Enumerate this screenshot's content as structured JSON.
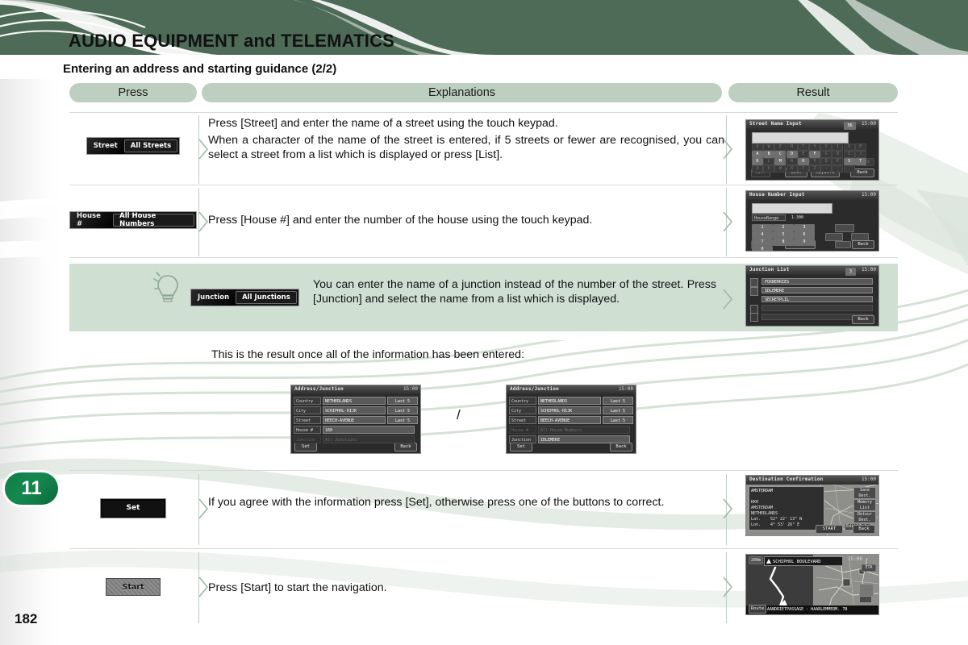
{
  "header": {
    "chapter_title": "AUDIO EQUIPMENT and TELEMATICS",
    "section_title": "Entering an address and starting guidance (2/2)",
    "band_color": "#4d6b57"
  },
  "columns": {
    "press": "Press",
    "explanations": "Explanations",
    "result": "Result"
  },
  "rows": [
    {
      "press_button": {
        "label": "Street",
        "value": "All Streets"
      },
      "explanation_lines": [
        "Press [Street] and enter the name of a street using the touch keypad.",
        "When a character of the name of the street is entered, if 5 streets or fewer are recognised, you can select a street from a list which is displayed or press [List]."
      ],
      "result_screen": {
        "title": "Street Name Input",
        "clock": "15:00",
        "indicator": "5K",
        "keys_row1": [
          "Q",
          "W",
          "E",
          "R",
          "T",
          "Y",
          "U",
          "I",
          "O",
          "P"
        ],
        "keys_row2": [
          "A",
          "B",
          "C",
          "D",
          "E",
          "F",
          "G",
          "H",
          "I",
          "J"
        ],
        "keys_row3": [
          "K",
          "L",
          "M",
          "N",
          "O",
          "P",
          "Q",
          "R",
          "S",
          "T"
        ],
        "keys_row4": [
          "U",
          "V",
          "W",
          "X",
          "Y",
          "Z",
          "-",
          "'",
          " "
        ],
        "more_label": "More",
        "buttons": [
          "Sym.",
          "List",
          "Keyword",
          "Back"
        ]
      }
    },
    {
      "press_button": {
        "label": "House #",
        "value": "All House Numbers"
      },
      "explanation_lines": [
        "Press [House #] and enter the number of the house using the touch keypad."
      ],
      "result_screen": {
        "title": "House Number Input",
        "clock": "15:00",
        "range_label": "HouseRange",
        "range_value": "1-300",
        "keys": [
          "1",
          "2",
          "3",
          "4",
          "5",
          "6",
          "7",
          "8",
          "9",
          "0"
        ],
        "buttons": [
          "Sym.",
          "Kevboard",
          "Back"
        ]
      }
    }
  ],
  "tip_row": {
    "press_button": {
      "label": "Junction",
      "value": "All Junctions"
    },
    "explanation": "You can enter the name of a junction instead of the number of the street. Press [Junction] and select the name from a list which is displayed.",
    "result_screen": {
      "title": "Junction List",
      "clock": "15:00",
      "indicator": "3",
      "items": [
        "FOXBERRIES",
        "IDLEMERE",
        "SECRETPLIL"
      ],
      "buttons": [
        "Back"
      ]
    }
  },
  "middle": {
    "intro": "This is the result once all of the information has been entered:",
    "separator": "/",
    "screen_left": {
      "title": "Address/Junction",
      "clock": "15:00",
      "fields": [
        {
          "label": "Country",
          "value": "NETHERLANDS",
          "side": "Last 5",
          "active": true
        },
        {
          "label": "City",
          "value": "SCHIPHOL-RIJK",
          "side": "Last 5",
          "active": true
        },
        {
          "label": "Street",
          "value": "BEECH-AVENUE",
          "side": "Last 5",
          "active": true
        },
        {
          "label": "House #",
          "value": "160",
          "side": "",
          "active": true
        },
        {
          "label": "Junction",
          "value": "All Junctions",
          "side": "",
          "active": false
        }
      ],
      "buttons": [
        "Set",
        "Back"
      ]
    },
    "screen_right": {
      "title": "Address/Junction",
      "clock": "15:00",
      "fields": [
        {
          "label": "Country",
          "value": "NETHERLANDS",
          "side": "Last 5",
          "active": true
        },
        {
          "label": "City",
          "value": "SCHIPHOL-RIJK",
          "side": "Last 5",
          "active": true
        },
        {
          "label": "Street",
          "value": "BEECH-AVENUE",
          "side": "Last 5",
          "active": true
        },
        {
          "label": "House #",
          "value": "All House Numbers",
          "side": "",
          "active": false
        },
        {
          "label": "Junction",
          "value": "IDLEMERE",
          "side": "",
          "active": true
        }
      ],
      "buttons": [
        "Set",
        "Back"
      ]
    }
  },
  "rows2": [
    {
      "press_button_label": "Set",
      "explanation": "If you agree with the information press [Set], otherwise press one of the buttons to correct.",
      "result_screen": {
        "title": "Destination Confirmation",
        "clock": "15:00",
        "subtitle": "AMSTERDAM",
        "info_lines": [
          "KKH",
          "AMSTERDAM",
          "NETHERLANDS"
        ],
        "lat_label": "Lat.",
        "lat_value": "52° 22' 13\" N",
        "lon_label": "Lon.",
        "lon_value": "4° 53' 26\" E",
        "side_buttons": [
          "Save Dest.",
          "Memory List",
          "Detour Dest.",
          "Info",
          "Edit"
        ],
        "bottom_buttons": [
          "START",
          "Back"
        ]
      }
    },
    {
      "press_button_label": "Start",
      "explanation": "Press [Start] to start the navigation.",
      "result_screen": {
        "scale": "200m",
        "road_banner": "SCHIPHOL BOULEVARD",
        "clock": "15:00",
        "eta": "ETA",
        "route_label": "Route",
        "route_value": "AANDRIETPASSAGE · HAARLEMMERM. 7B"
      }
    }
  ],
  "footer": {
    "chapter_badge": "11",
    "page_number": "182"
  }
}
